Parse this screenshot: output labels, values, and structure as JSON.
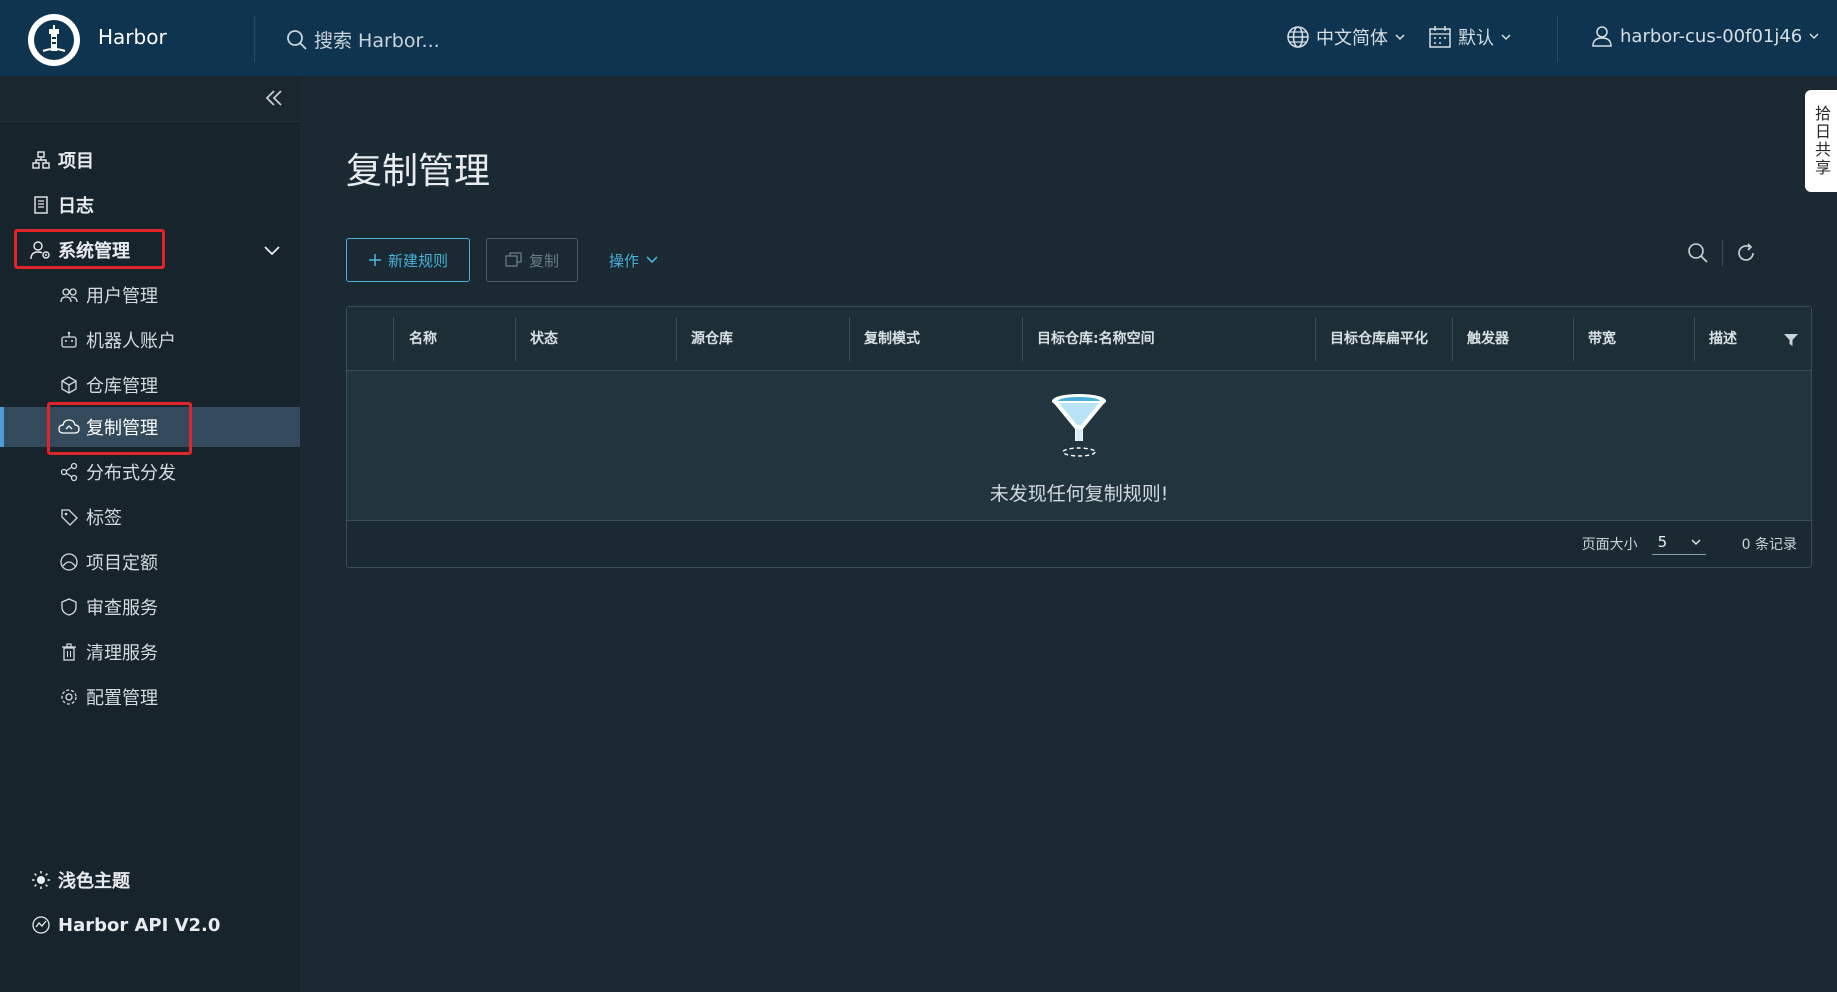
{
  "header": {
    "app_name": "Harbor",
    "search_placeholder": "搜索 Harbor...",
    "language": "中文简体",
    "datetime_format": "默认",
    "username": "harbor-cus-00f01j46"
  },
  "sidebar": {
    "items": [
      {
        "label": "项目",
        "icon": "projects-icon"
      },
      {
        "label": "日志",
        "icon": "logs-icon"
      },
      {
        "label": "系统管理",
        "icon": "admin-icon"
      }
    ],
    "sub_items": [
      {
        "label": "用户管理",
        "icon": "users-icon"
      },
      {
        "label": "机器人账户",
        "icon": "robot-icon"
      },
      {
        "label": "仓库管理",
        "icon": "registry-icon"
      },
      {
        "label": "复制管理",
        "icon": "replication-icon"
      },
      {
        "label": "分布式分发",
        "icon": "share-icon"
      },
      {
        "label": "标签",
        "icon": "tag-icon"
      },
      {
        "label": "项目定额",
        "icon": "quota-icon"
      },
      {
        "label": "审查服务",
        "icon": "shield-icon"
      },
      {
        "label": "清理服务",
        "icon": "trash-icon"
      },
      {
        "label": "配置管理",
        "icon": "gear-icon"
      }
    ],
    "bottom": [
      {
        "label": "浅色主题",
        "icon": "sun-icon"
      },
      {
        "label": "Harbor API V2.0",
        "icon": "api-icon"
      }
    ]
  },
  "main": {
    "title": "复制管理",
    "new_rule_label": "新建规则",
    "copy_label": "复制",
    "ops_label": "操作",
    "columns": [
      "名称",
      "状态",
      "源仓库",
      "复制模式",
      "目标仓库:名称空间",
      "目标仓库扁平化",
      "触发器",
      "带宽",
      "描述"
    ],
    "empty_text": "未发现任何复制规则!",
    "page_size_label": "页面大小",
    "page_size_value": "5",
    "record_count": "0 条记录"
  },
  "side_tab": {
    "label": "拾日共享"
  },
  "colors": {
    "header_bg": "#0e3450",
    "accent": "#49afd9",
    "highlight_red": "#e0242b"
  }
}
